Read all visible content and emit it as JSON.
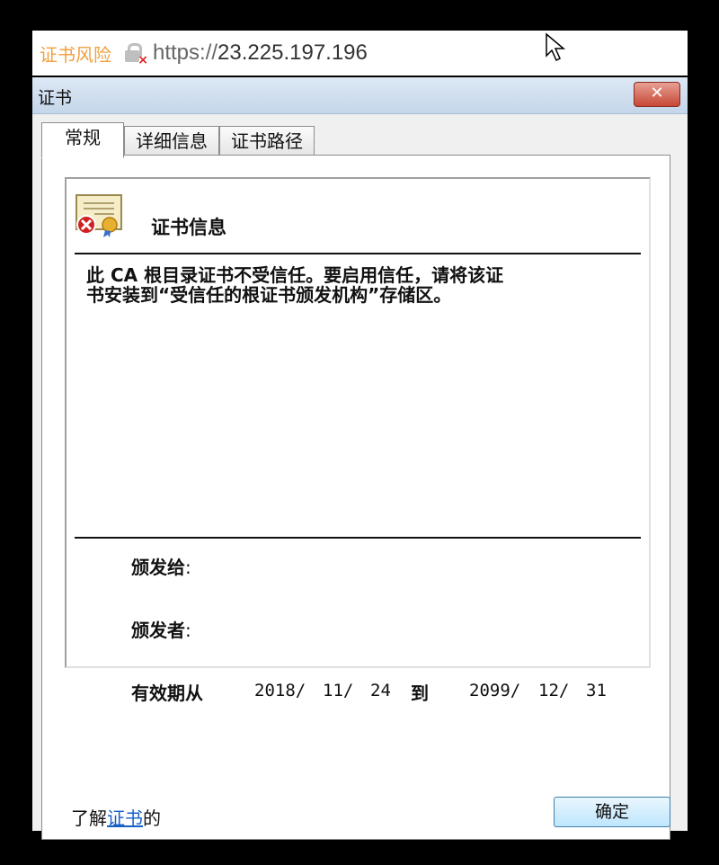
{
  "browser": {
    "cert_risk": "证书风险",
    "url_scheme": "https://",
    "url_host": "23.225.197.196"
  },
  "dialog": {
    "title": "证书",
    "close_label": "✕",
    "tabs": [
      {
        "label": "常规",
        "active": true
      },
      {
        "label": "详细信息",
        "active": false
      },
      {
        "label": "证书路径",
        "active": false
      }
    ],
    "info_heading": "证书信息",
    "warning_line1": "此 CA 根目录证书不受信任。要启用信任，请将该证",
    "warning_line2": "书安装到“受信任的根证书颁发机构”存储区。",
    "issued_to_label": "颁发给",
    "issued_by_label": "颁发者",
    "colon": ":",
    "valid_from_label": "有效期从",
    "valid_from_year": "2018/",
    "valid_from_month": "11/",
    "valid_from_day": "24",
    "valid_to_label": "到",
    "valid_to_year": "2099/",
    "valid_to_month": "12/",
    "valid_to_day": "31",
    "learn_prefix": "了解",
    "learn_link": "证书",
    "learn_suffix": "的",
    "ok_label": "确定"
  },
  "icons": {
    "lock": "broken-lock-icon",
    "certificate": "certificate-error-icon",
    "cursor": "mouse-cursor-icon"
  },
  "colors": {
    "risk_text": "#f0a040",
    "link": "#1660c8",
    "close_button": "#c74735"
  }
}
